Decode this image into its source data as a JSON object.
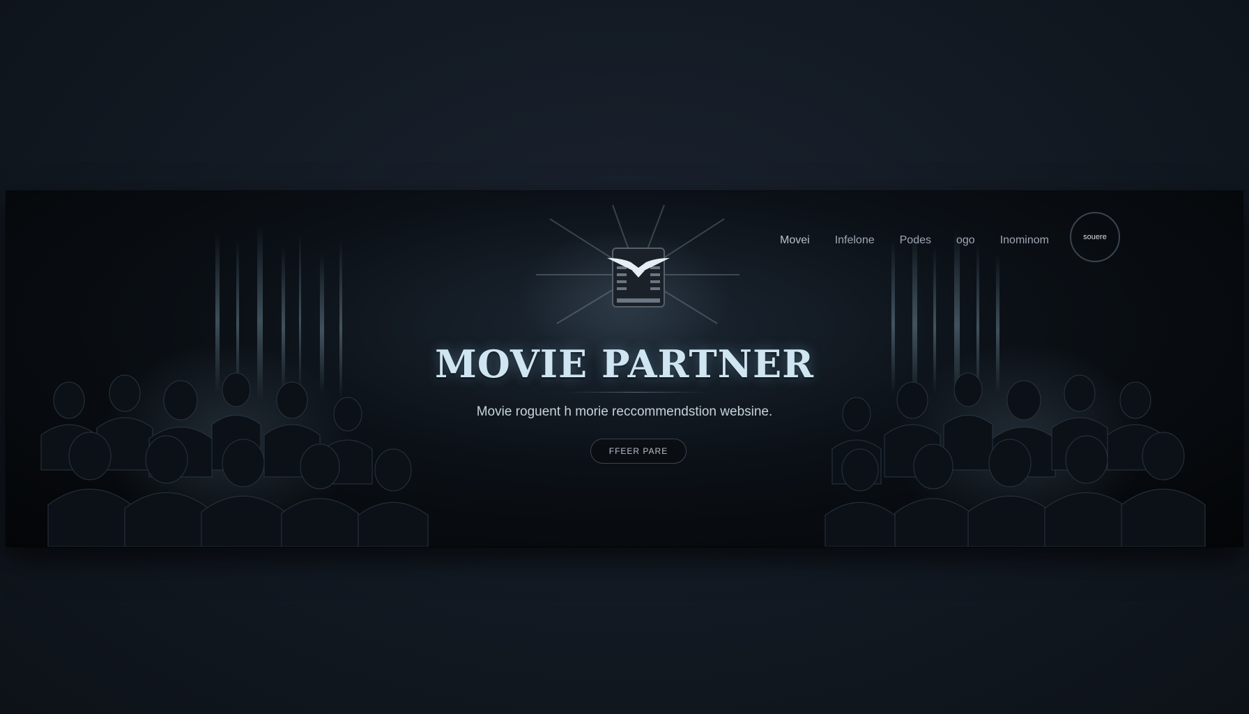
{
  "nav": {
    "items": [
      {
        "label": "Movei"
      },
      {
        "label": "Infelone"
      },
      {
        "label": "Podes"
      },
      {
        "label": "ogo"
      },
      {
        "label": "Inominom"
      }
    ],
    "circle_label": "souere"
  },
  "hero": {
    "title": "MOVIE PARTNER",
    "subtitle": "Movie roguent h morie reccommendstion  websine.",
    "cta_label": "FFEER PARE"
  },
  "logo": {
    "icon": "winged-film-clapper-icon"
  },
  "colors": {
    "background": "#121922",
    "banner": "#05080b",
    "title": "#cfe6f2",
    "nav_text": "#9fa8b4"
  }
}
